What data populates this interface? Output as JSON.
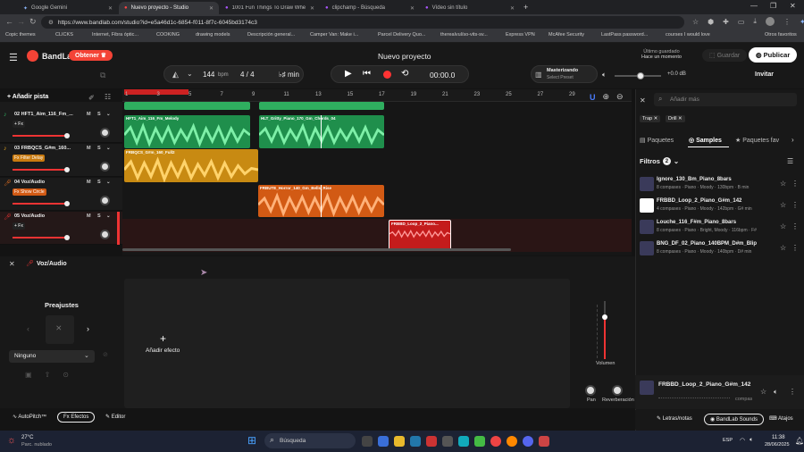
{
  "browser": {
    "tabs": [
      {
        "title": "Google Gemini"
      },
      {
        "title": "Nuevo proyecto - Studio"
      },
      {
        "title": "1001 Fun Things To Draw When Y"
      },
      {
        "title": "clipchamp - Búsqueda"
      },
      {
        "title": "Vídeo sin título"
      }
    ],
    "url": "https://www.bandlab.com/studio?id=e5a46d1c-6854-f011-8f7c-6045bd3174c3",
    "bookmarks": [
      "Copic themes",
      "CLICKS",
      "Internet, Fibra óptic...",
      "COOKING",
      "drawing models",
      "Descripción general...",
      "Camper Van: Make i...",
      "Parcel Delivery Quo...",
      "therealvul/so-vits-sv...",
      "Express VPN",
      "McAfee Security",
      "LastPass password...",
      "courses I would love",
      "Otros favoritos"
    ]
  },
  "header": {
    "brand": "BandLab",
    "upgrade": "Obtener",
    "bpm_value": "144",
    "bpm_unit": "bpm",
    "time_sig": "4 / 4",
    "key": "min",
    "time": "00:00.0",
    "project_title": "Nuevo proyecto",
    "saved_line1": "Último guardado",
    "saved_line2": "Hace un momento",
    "save": "Guardar",
    "publish": "Publicar",
    "mastering_title": "Masterizando",
    "mastering_sub": "Select Preset",
    "master_db": "+0.0 dB",
    "invite": "Invitar"
  },
  "tracks_header": {
    "add_track": "Añadir pista"
  },
  "ruler": [
    "1",
    "3",
    "5",
    "7",
    "9",
    "11",
    "13",
    "15",
    "17",
    "19",
    "21",
    "23",
    "25",
    "27",
    "29"
  ],
  "tracks": [
    {
      "name": "02  HFT1_Aim_116_Fm_...",
      "tag": "+ Fx",
      "m": "M",
      "s": "S"
    },
    {
      "name": "03  FRBQCS_G#m_160...",
      "tag": "Fx Filter Delay",
      "m": "M",
      "s": "S"
    },
    {
      "name": "04  Voz/Audio",
      "tag": "Fx Show Circle",
      "m": "M",
      "s": "S"
    },
    {
      "name": "05  Voz/Audio",
      "tag": "+ Fx",
      "m": "M",
      "s": "S"
    }
  ],
  "clips": [
    {
      "name": "HFT1_Aim_116_Fm_Melody"
    },
    {
      "name": "HLT_Gritty_Piano_170_Gm_Chords_04"
    },
    {
      "name": "FRBQCS_G#m_160_Full2"
    },
    {
      "name": "FRBUTE_Horror_140_Gm_Bells_Rise"
    },
    {
      "name": "FRBBD_Loop_2_Piano..."
    }
  ],
  "fx": {
    "track": "Voz/Audio",
    "presets": "Preajustes",
    "preset_value": "Ninguno",
    "add_effect": "Añadir efecto",
    "volume": "Volumen",
    "pan": "Pan",
    "reverb": "Reverberación",
    "tabs": [
      "AutoPitch™",
      "Efectos",
      "Editor"
    ]
  },
  "right": {
    "search_placeholder": "Añadir más",
    "chips": [
      "Trap",
      "Drill"
    ],
    "tabs": [
      "Paquetes",
      "Samples",
      "Paquetes fav"
    ],
    "filters": "Filtros",
    "filters_count": "2",
    "samples": [
      {
        "title": "Ignore_130_Bm_Piano_8bars",
        "meta": "8 compases · Piano · Moody · 130bpm · B min"
      },
      {
        "title": "FRBBD_Loop_2_Piano_G#m_142",
        "meta": "4 compases · Piano · Moody · 142bpm · G# min"
      },
      {
        "title": "Louche_116_F#m_Piano_8bars",
        "meta": "8 compases · Piano · Bright, Moody · 116bpm · F#"
      },
      {
        "title": "BNG_DF_02_Piano_140BPM_D#m_Blip",
        "meta": "8 compases · Piano · Moody · 140bpm · D# min"
      }
    ],
    "player_title": "FRBBD_Loop_2_Piano_G#m_142",
    "player_sub": "compas",
    "bottom": [
      "Letras/notas",
      "BandLab Sounds",
      "Atajos"
    ]
  },
  "taskbar": {
    "temp": "27°C",
    "weather": "Parc. nublado",
    "search": "Búsqueda",
    "lang": "ESP",
    "time": "11:38",
    "date": "28/06/2025"
  },
  "colors": {
    "accent": "#f44336",
    "green": "#2fae5f",
    "yellow": "#e0a21c",
    "orange": "#e8701f",
    "red": "#d22"
  }
}
